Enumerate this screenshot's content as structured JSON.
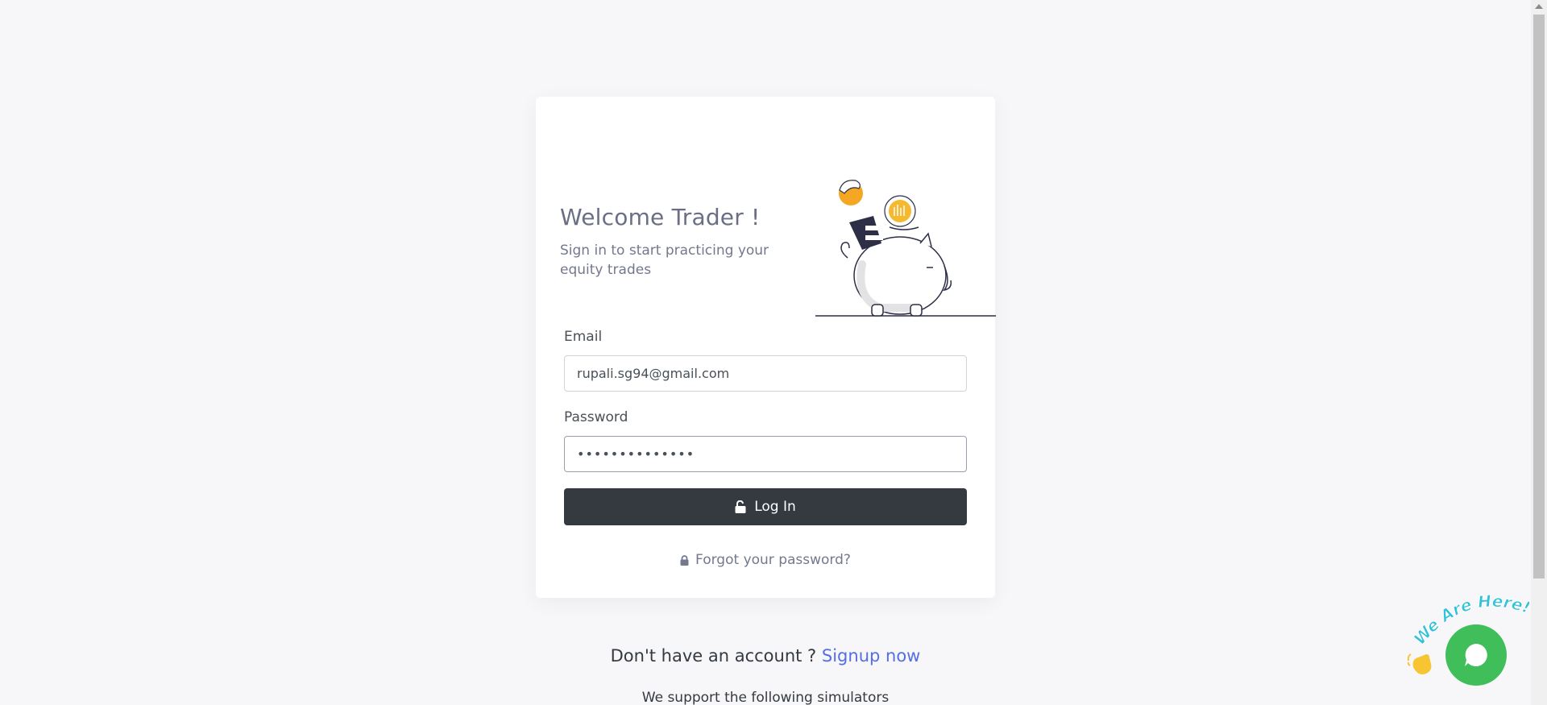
{
  "welcome": {
    "title": "Welcome Trader !",
    "subtitle": "Sign in to start practicing your equity trades"
  },
  "form": {
    "email_label": "Email",
    "email_value": "rupali.sg94@gmail.com",
    "password_label": "Password",
    "password_value": "••••••••••••••",
    "login_label": "Log In",
    "forgot_label": "Forgot your password?"
  },
  "signup": {
    "prompt": "Don't have an account ?",
    "link": "Signup now"
  },
  "support_text": "We support the following simulators",
  "chat": {
    "badge_text": "We Are Here!"
  },
  "colors": {
    "accent": "#556ee6",
    "button": "#343a40",
    "chat": "#3fbe5a",
    "coin": "#f5b82e"
  }
}
